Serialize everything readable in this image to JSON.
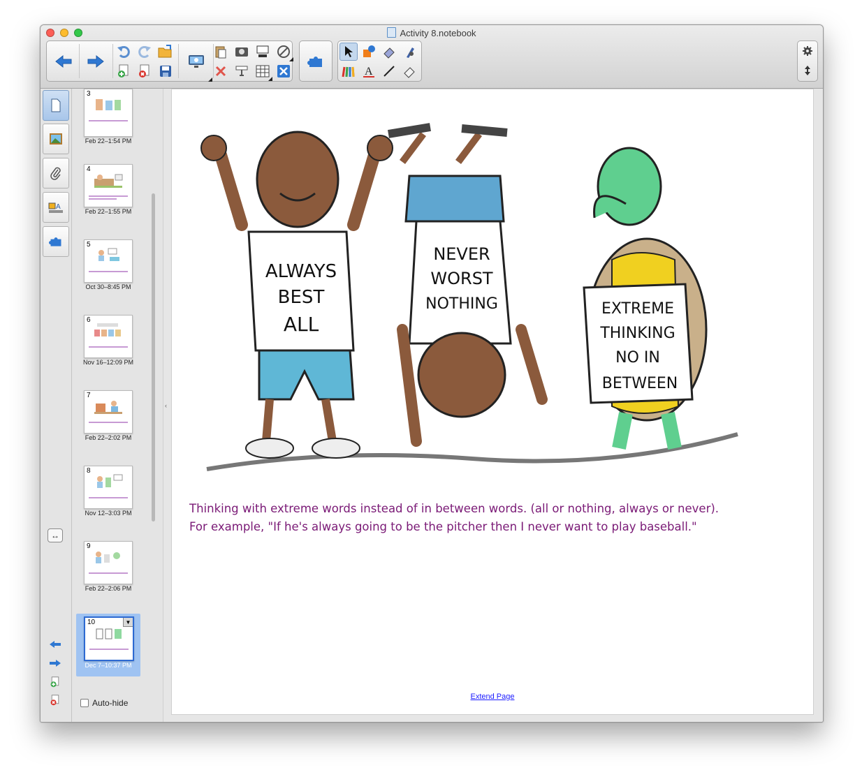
{
  "window": {
    "title": "Activity 8.notebook"
  },
  "toolbar": {
    "buttons": [
      "back-icon",
      "forward-icon",
      "undo-icon",
      "redo-icon",
      "open-icon",
      "add-page-icon",
      "delete-page-icon",
      "save-icon",
      "display-icon",
      "paste-icon",
      "screen-capture-icon",
      "screen-shade-icon",
      "tools-icon",
      "delete-icon",
      "document-camera-icon",
      "table-icon",
      "close-icon",
      "add-ons-icon",
      "select-icon",
      "shapes-icon",
      "eraser-icon",
      "magic-pen-icon",
      "pens-icon",
      "text-icon",
      "line-icon",
      "eraser2-icon",
      "gear-icon",
      "expand-icon"
    ]
  },
  "sidebar": {
    "tabs": [
      "page-sorter-icon",
      "gallery-icon",
      "attachments-icon",
      "properties-icon",
      "add-ons-icon"
    ],
    "slides": [
      {
        "num": "3",
        "date": "Feb 22–1:54 PM"
      },
      {
        "num": "4",
        "date": "Feb 22–1:55 PM"
      },
      {
        "num": "5",
        "date": "Oct 30–8:45 PM"
      },
      {
        "num": "6",
        "date": "Nov 16–12:09 PM"
      },
      {
        "num": "7",
        "date": "Feb 22–2:02 PM"
      },
      {
        "num": "8",
        "date": "Nov 12–3:03 PM"
      },
      {
        "num": "9",
        "date": "Feb 22–2:06 PM"
      },
      {
        "num": "10",
        "date": "Dec 7–10:37 PM"
      }
    ],
    "autohide_label": "Auto-hide"
  },
  "canvas": {
    "shirt1": [
      "ALWAYS",
      "BEST",
      "ALL"
    ],
    "shirt2": [
      "NEVER",
      "WORST",
      "NOTHING"
    ],
    "sign": [
      "EXTREME",
      "THINKING",
      "NO IN",
      "BETWEEN"
    ],
    "caption_line1": "Thinking with extreme words instead of in between words. (all or nothing, always or never).",
    "caption_line2": "For example, \"If he's always going to be the pitcher then I never want to play baseball.\"",
    "extend_label": "Extend Page"
  },
  "colors": {
    "caption": "#7a1a76",
    "accent": "#2d6ad2",
    "link": "#1a1aff"
  }
}
